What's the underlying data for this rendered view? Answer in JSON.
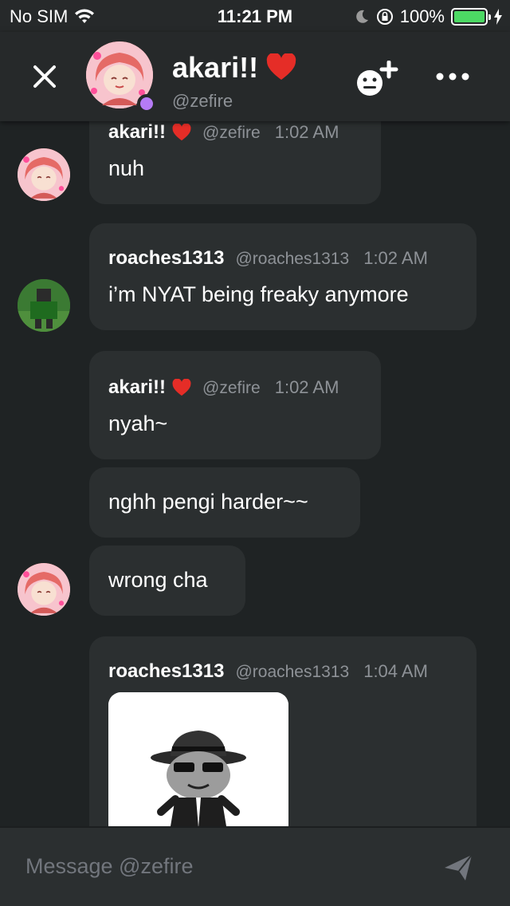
{
  "status_bar": {
    "carrier": "No SIM",
    "time": "11:21 PM",
    "battery": "100%",
    "battery_level": 1.0,
    "icons": [
      "wifi-icon",
      "moon-icon",
      "orientation-lock-icon",
      "battery-icon",
      "charging-icon"
    ]
  },
  "header": {
    "name": "akari!!",
    "handle": "@zefire",
    "name_emoji": "heart-emoji",
    "icons": [
      "close-icon",
      "add-friend-icon",
      "more-icon"
    ]
  },
  "messages": [
    {
      "author": "akari!!",
      "handle": "@zefire",
      "time": "1:02 AM",
      "lines": [
        "nuh"
      ]
    },
    {
      "author": "roaches1313",
      "handle": "@roaches1313",
      "time": "1:02 AM",
      "lines": [
        "i’m NYAT being freaky anymore"
      ]
    },
    {
      "author": "akari!!",
      "handle": "@zefire",
      "time": "1:02 AM",
      "lines": [
        "nyah~",
        "nghh pengi harder~~",
        "wrong cha"
      ]
    },
    {
      "author": "roaches1313",
      "handle": "@roaches1313",
      "time": "1:04 AM",
      "lines": [],
      "attachment": "image"
    }
  ],
  "composer": {
    "placeholder": "Message @zefire"
  },
  "colors": {
    "background": "#1f2324",
    "bubble": "#2b2f30",
    "header": "#26292a",
    "muted": "#8e9297",
    "heart": "#e52d27",
    "status_dot": "#b57bf5",
    "battery": "#4cd964"
  }
}
